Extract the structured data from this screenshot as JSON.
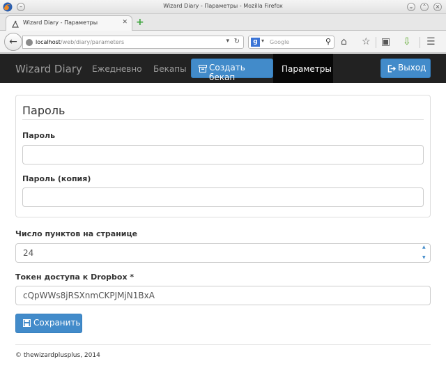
{
  "window": {
    "title": "Wizard Diary - Параметры - Mozilla Firefox"
  },
  "browser": {
    "tab_title": "Wizard Diary - Параметры",
    "url_host": "localhost",
    "url_path": "/web/diary/parameters",
    "search_placeholder": "Google"
  },
  "site_nav": {
    "brand": "Wizard Diary",
    "items": [
      {
        "label": "Ежедневно"
      },
      {
        "label": "Бекапы"
      }
    ],
    "create_backup_label": "Создать бекап",
    "active_item": "Параметры",
    "logout_label": "Выход"
  },
  "form": {
    "password_legend": "Пароль",
    "password_label": "Пароль",
    "password_value": "",
    "password_repeat_label": "Пароль (копия)",
    "password_repeat_value": "",
    "items_per_page_label": "Число пунктов на странице",
    "items_per_page_value": "24",
    "dropbox_token_label": "Токен доступа к Dropbox *",
    "dropbox_token_value": "cQpWWs8jRSXnmCKPJMjN1BxA",
    "save_label": "Сохранить"
  },
  "footer": {
    "copyright": "© thewizardplusplus, 2014"
  },
  "colors": {
    "navbar_bg": "#222222",
    "primary": "#428bca",
    "active_nav": "#080808"
  }
}
